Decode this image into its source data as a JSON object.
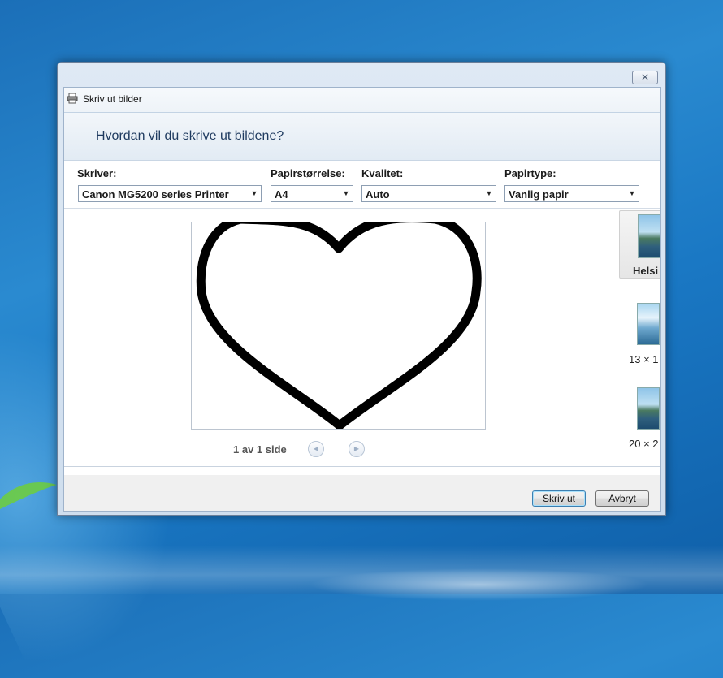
{
  "window": {
    "title": "Skriv ut bilder",
    "close_glyph": "✕"
  },
  "header": {
    "question": "Hvordan vil du skrive ut bildene?"
  },
  "options": {
    "printer": {
      "label": "Skriver:",
      "value": "Canon MG5200 series Printer"
    },
    "paper_size": {
      "label": "Papirstørrelse:",
      "value": "A4"
    },
    "quality": {
      "label": "Kvalitet:",
      "value": "Auto"
    },
    "paper_type": {
      "label": "Papirtype:",
      "value": "Vanlig papir"
    }
  },
  "preview": {
    "page_indicator": "1 av 1 side",
    "prev_icon": "arrow-left-icon",
    "next_icon": "arrow-right-icon"
  },
  "layouts": [
    {
      "label": "Helsi"
    },
    {
      "label": "13 × 1"
    },
    {
      "label": "20 × 2"
    }
  ],
  "buttons": {
    "print": "Skriv ut",
    "cancel": "Avbryt"
  },
  "colors": {
    "desktop": "#1b6fb8",
    "window_frame": "#cfdeee",
    "primary_button_border": "#3c7fb1"
  }
}
